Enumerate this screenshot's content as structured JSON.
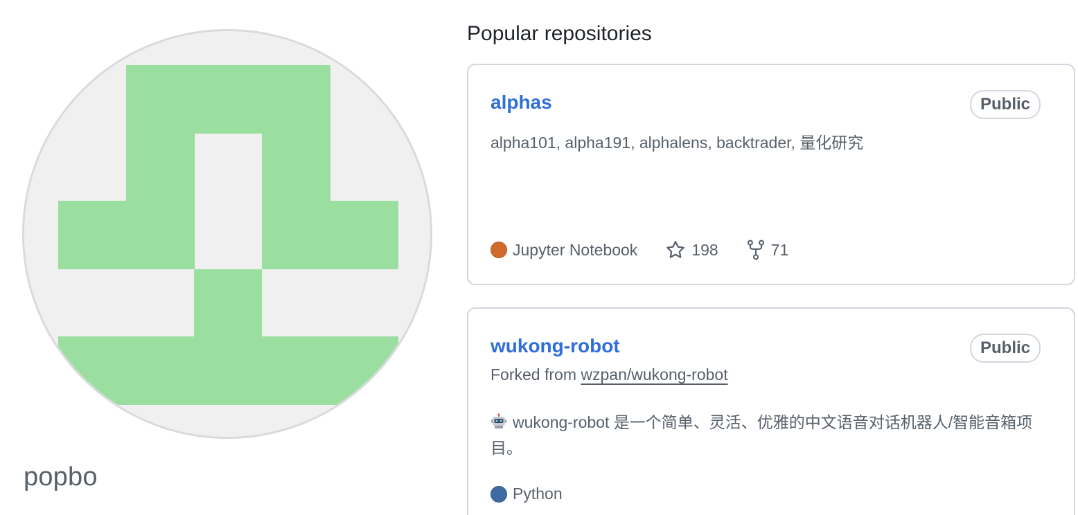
{
  "profile": {
    "username": "popbo",
    "avatar_colors": {
      "background": "#f0f0f0",
      "foreground": "#9bdfa0"
    }
  },
  "section_title": "Popular repositories",
  "repos": [
    {
      "name": "alphas",
      "visibility": "Public",
      "description": "alpha101, alpha191, alphalens, backtrader, 量化研究",
      "language": "Jupyter Notebook",
      "language_color": "#d06a2b",
      "stars": "198",
      "forks": "71"
    },
    {
      "name": "wukong-robot",
      "visibility": "Public",
      "forked_prefix": "Forked from",
      "forked_from": "wzpan/wukong-robot",
      "description": "wukong-robot 是一个简单、灵活、优雅的中文语音对话机器人/智能音箱项目。",
      "description_icon": "robot-emoji-icon",
      "language": "Python",
      "language_color": "#3d6aa3"
    }
  ],
  "colors": {
    "link": "#2f6fd6",
    "muted_text": "#57606a",
    "border": "#d0d7de"
  }
}
